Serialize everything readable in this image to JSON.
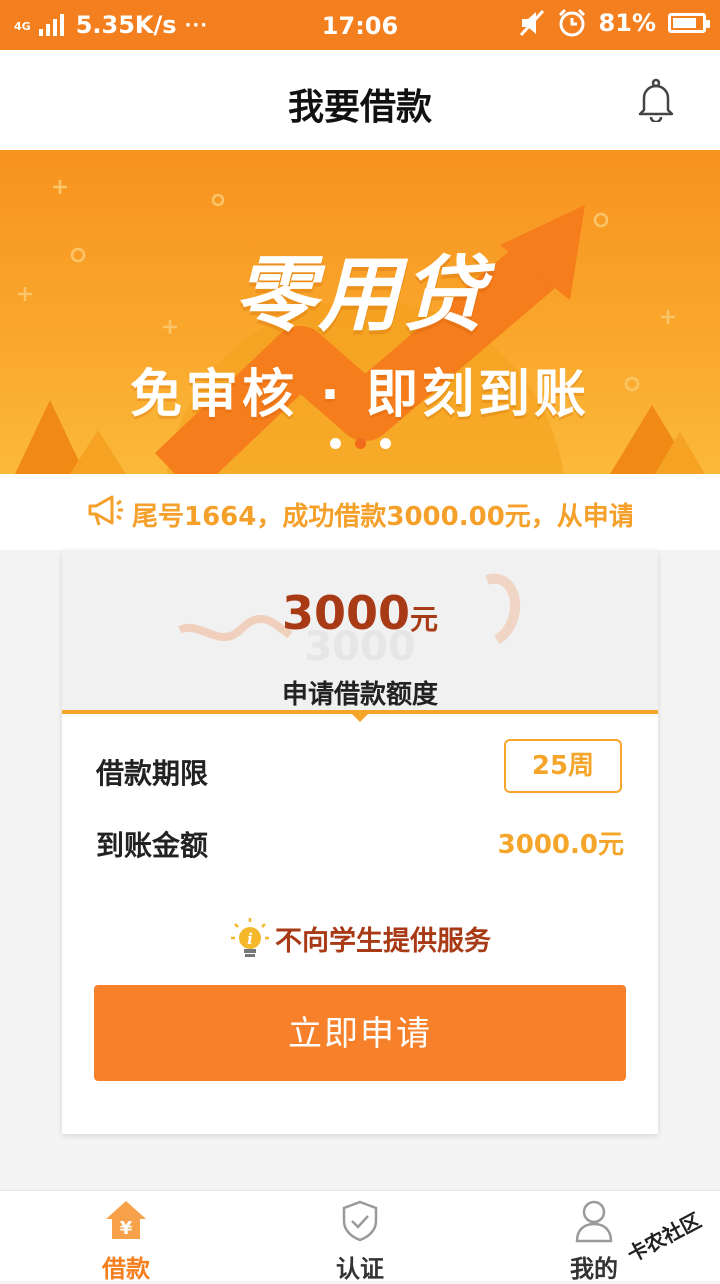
{
  "status_bar": {
    "network": "4G",
    "speed": "5.35K/s",
    "more": "···",
    "time": "17:06",
    "battery_percent": "81%",
    "battery_level": 0.81
  },
  "header": {
    "title": "我要借款"
  },
  "banner": {
    "title": "零用贷",
    "subtitle": "免审核 · 即刻到账",
    "slide_count": 3,
    "active_slide": 2
  },
  "notice": {
    "text": "尾号1664，成功借款3000.00元，从申请"
  },
  "loan_card": {
    "amount": "3000",
    "amount_unit": "元",
    "amount_label": "申请借款额度",
    "period_label": "借款期限",
    "period_value": "25周",
    "arrive_label": "到账金额",
    "arrive_value": "3000.0元",
    "tip": "不向学生提供服务",
    "apply_button": "立即申请"
  },
  "tabbar": {
    "items": [
      {
        "label": "借款",
        "icon": "home-yuan-icon",
        "active": true
      },
      {
        "label": "认证",
        "icon": "shield-check-icon",
        "active": false
      },
      {
        "label": "我的",
        "icon": "user-icon",
        "active": false
      }
    ]
  },
  "watermark": {
    "text": "卡农社区"
  },
  "colors": {
    "accent": "#f47f1e",
    "highlight": "#f5a52a",
    "dark_red": "#a83a16",
    "button": "#f7802a"
  }
}
